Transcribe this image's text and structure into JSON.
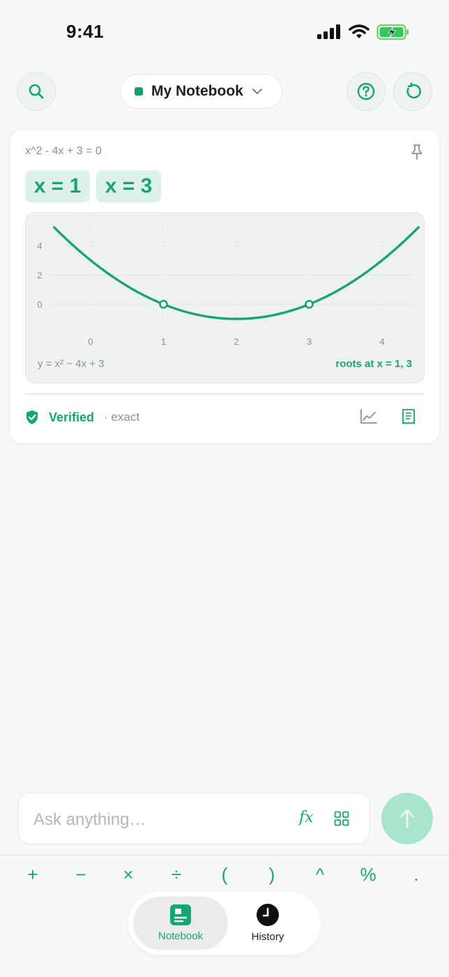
{
  "status_bar": {
    "time": "9:41"
  },
  "header": {
    "notebook_name": "My Notebook",
    "search_icon": "search-icon",
    "help_icon": "help-circle-icon",
    "reset_icon": "rotate-icon"
  },
  "result": {
    "expression": "x^2 - 4x + 3 = 0",
    "solutions": [
      "x = 1",
      "x = 3"
    ],
    "plot_equation": "y = x² − 4x + 3",
    "plot_roots": "roots at x = 1, 3",
    "verified_label": "Verified",
    "verified_detail": "· exact"
  },
  "chart_data": {
    "type": "line",
    "function": "y = x² − 4x + 3",
    "x_ticks": [
      "0",
      "1",
      "2",
      "3",
      "4"
    ],
    "y_ticks": [
      "4",
      "2",
      "0"
    ],
    "xlim": [
      -0.5,
      4.5
    ],
    "ylim": [
      -1.5,
      5.5
    ],
    "points": [
      {
        "x": -0.5,
        "y": 5.25
      },
      {
        "x": 0,
        "y": 3
      },
      {
        "x": 0.5,
        "y": 1.25
      },
      {
        "x": 1,
        "y": 0
      },
      {
        "x": 1.5,
        "y": -0.75
      },
      {
        "x": 2,
        "y": -1
      },
      {
        "x": 2.5,
        "y": -0.75
      },
      {
        "x": 3,
        "y": 0
      },
      {
        "x": 3.5,
        "y": 1.25
      },
      {
        "x": 4,
        "y": 3
      },
      {
        "x": 4.5,
        "y": 5.25
      }
    ],
    "roots": [
      {
        "x": 1,
        "y": 0
      },
      {
        "x": 3,
        "y": 0
      }
    ],
    "grid": true,
    "color": "#17a571"
  },
  "input": {
    "placeholder": "Ask anything…",
    "fx_label": "𝑓x"
  },
  "operators": [
    "+",
    "−",
    "×",
    "÷",
    "(",
    ")",
    "^",
    "%",
    "."
  ],
  "tabs": [
    {
      "label": "Notebook",
      "active": true
    },
    {
      "label": "History",
      "active": false
    }
  ],
  "colors": {
    "accent": "#17a571",
    "chip_bg": "#dcf2e8",
    "background": "#f7f9f8"
  }
}
